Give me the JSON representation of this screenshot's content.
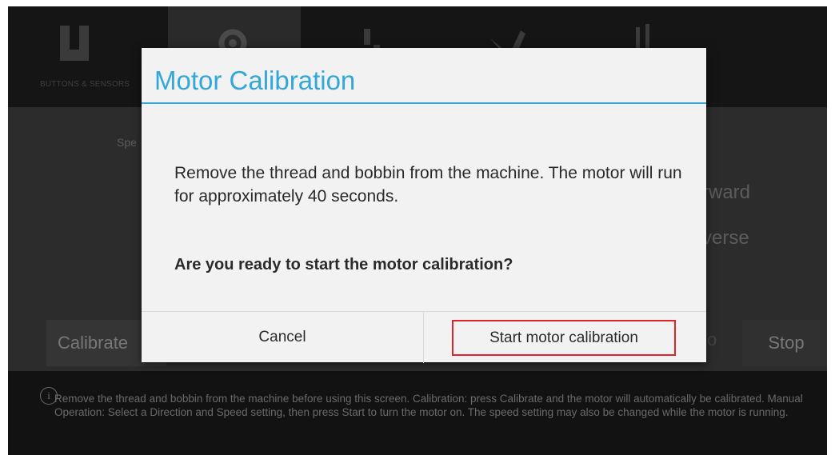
{
  "tabs": [
    {
      "label": "BUTTONS & SENSORS",
      "icon": "u-shape-icon",
      "active": false
    },
    {
      "label": "",
      "icon": "gears-icon",
      "active": true
    },
    {
      "label": "",
      "icon": "bars-icon",
      "active": false
    },
    {
      "label": "",
      "icon": "tools-icon",
      "active": false
    },
    {
      "label": "",
      "icon": "adjust-icon",
      "active": false
    }
  ],
  "background": {
    "speed_label": "Spe",
    "direction_forward": "rward",
    "direction_reverse": "verse",
    "calibrate_label": "Calibrate",
    "stop_label": "Stop",
    "info_text": "Remove the thread and bobbin from the machine before using this screen. Calibration: press Calibrate and the motor will automatically be calibrated. Manual Operation: Select a Direction and Speed setting, then press Start to turn the motor on. The speed setting may also be changed while the motor is running."
  },
  "dialog": {
    "title": "Motor Calibration",
    "message": "Remove the thread and bobbin from the machine. The motor will run for approximately 40 seconds.",
    "question": "Are you ready to start the motor calibration?",
    "cancel_label": "Cancel",
    "confirm_label": "Start motor calibration"
  },
  "colors": {
    "accent": "#33a8d8",
    "highlight_border": "#e0232b"
  }
}
